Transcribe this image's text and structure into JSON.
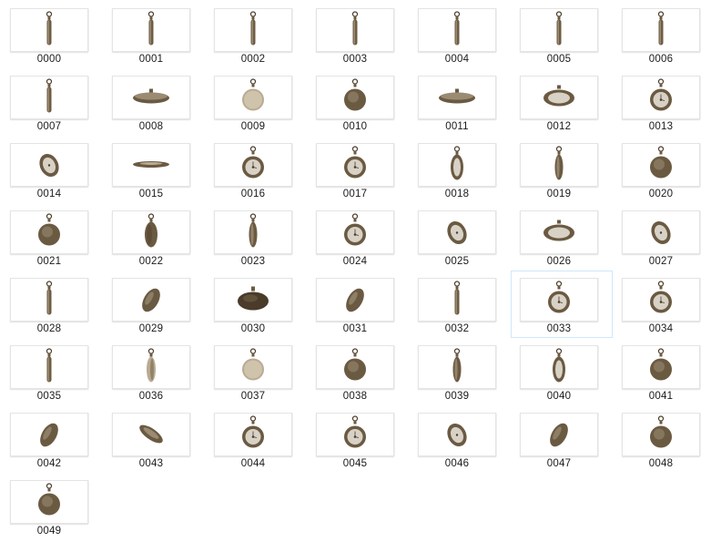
{
  "explorer": {
    "selected_index": 33,
    "items": [
      {
        "label": "0000",
        "icon": "pocket-watch-icon",
        "view": "edge"
      },
      {
        "label": "0001",
        "icon": "pocket-watch-icon",
        "view": "edge"
      },
      {
        "label": "0002",
        "icon": "pocket-watch-icon",
        "view": "edge"
      },
      {
        "label": "0003",
        "icon": "pocket-watch-icon",
        "view": "edge"
      },
      {
        "label": "0004",
        "icon": "pocket-watch-icon",
        "view": "edge"
      },
      {
        "label": "0005",
        "icon": "pocket-watch-icon",
        "view": "edge"
      },
      {
        "label": "0006",
        "icon": "pocket-watch-icon",
        "view": "edge"
      },
      {
        "label": "0007",
        "icon": "pocket-watch-icon",
        "view": "edge"
      },
      {
        "label": "0008",
        "icon": "pocket-watch-icon",
        "view": "flat"
      },
      {
        "label": "0009",
        "icon": "pocket-watch-icon",
        "view": "front-light"
      },
      {
        "label": "0010",
        "icon": "pocket-watch-icon",
        "view": "back"
      },
      {
        "label": "0011",
        "icon": "pocket-watch-icon",
        "view": "flat"
      },
      {
        "label": "0012",
        "icon": "pocket-watch-icon",
        "view": "flat-face"
      },
      {
        "label": "0013",
        "icon": "pocket-watch-icon",
        "view": "face"
      },
      {
        "label": "0014",
        "icon": "pocket-watch-icon",
        "view": "face-tilt"
      },
      {
        "label": "0015",
        "icon": "pocket-watch-icon",
        "view": "flat-thin"
      },
      {
        "label": "0016",
        "icon": "pocket-watch-icon",
        "view": "face"
      },
      {
        "label": "0017",
        "icon": "pocket-watch-icon",
        "view": "face"
      },
      {
        "label": "0018",
        "icon": "pocket-watch-icon",
        "view": "face-narrow"
      },
      {
        "label": "0019",
        "icon": "pocket-watch-icon",
        "view": "edge-thick"
      },
      {
        "label": "0020",
        "icon": "pocket-watch-icon",
        "view": "back"
      },
      {
        "label": "0021",
        "icon": "pocket-watch-icon",
        "view": "back"
      },
      {
        "label": "0022",
        "icon": "pocket-watch-icon",
        "view": "narrow"
      },
      {
        "label": "0023",
        "icon": "pocket-watch-icon",
        "view": "edge-thick"
      },
      {
        "label": "0024",
        "icon": "pocket-watch-icon",
        "view": "face"
      },
      {
        "label": "0025",
        "icon": "pocket-watch-icon",
        "view": "face-tilt"
      },
      {
        "label": "0026",
        "icon": "pocket-watch-icon",
        "view": "flat-face"
      },
      {
        "label": "0027",
        "icon": "pocket-watch-icon",
        "view": "face-tilt"
      },
      {
        "label": "0028",
        "icon": "pocket-watch-icon",
        "view": "edge"
      },
      {
        "label": "0029",
        "icon": "pocket-watch-icon",
        "view": "back-tilt"
      },
      {
        "label": "0030",
        "icon": "pocket-watch-icon",
        "view": "flat-dark"
      },
      {
        "label": "0031",
        "icon": "pocket-watch-icon",
        "view": "back-tilt"
      },
      {
        "label": "0032",
        "icon": "pocket-watch-icon",
        "view": "edge"
      },
      {
        "label": "0033",
        "icon": "pocket-watch-icon",
        "view": "face"
      },
      {
        "label": "0034",
        "icon": "pocket-watch-icon",
        "view": "face"
      },
      {
        "label": "0035",
        "icon": "pocket-watch-icon",
        "view": "edge"
      },
      {
        "label": "0036",
        "icon": "pocket-watch-icon",
        "view": "edge-light"
      },
      {
        "label": "0037",
        "icon": "pocket-watch-icon",
        "view": "front-light"
      },
      {
        "label": "0038",
        "icon": "pocket-watch-icon",
        "view": "back"
      },
      {
        "label": "0039",
        "icon": "pocket-watch-icon",
        "view": "edge-thick"
      },
      {
        "label": "0040",
        "icon": "pocket-watch-icon",
        "view": "face-narrow"
      },
      {
        "label": "0041",
        "icon": "pocket-watch-icon",
        "view": "back"
      },
      {
        "label": "0042",
        "icon": "pocket-watch-icon",
        "view": "back-tilt"
      },
      {
        "label": "0043",
        "icon": "pocket-watch-icon",
        "view": "flat-tilt"
      },
      {
        "label": "0044",
        "icon": "pocket-watch-icon",
        "view": "face"
      },
      {
        "label": "0045",
        "icon": "pocket-watch-icon",
        "view": "face"
      },
      {
        "label": "0046",
        "icon": "pocket-watch-icon",
        "view": "face-tilt"
      },
      {
        "label": "0047",
        "icon": "pocket-watch-icon",
        "view": "back-tilt"
      },
      {
        "label": "0048",
        "icon": "pocket-watch-icon",
        "view": "back"
      },
      {
        "label": "0049",
        "icon": "pocket-watch-icon",
        "view": "back"
      }
    ]
  }
}
